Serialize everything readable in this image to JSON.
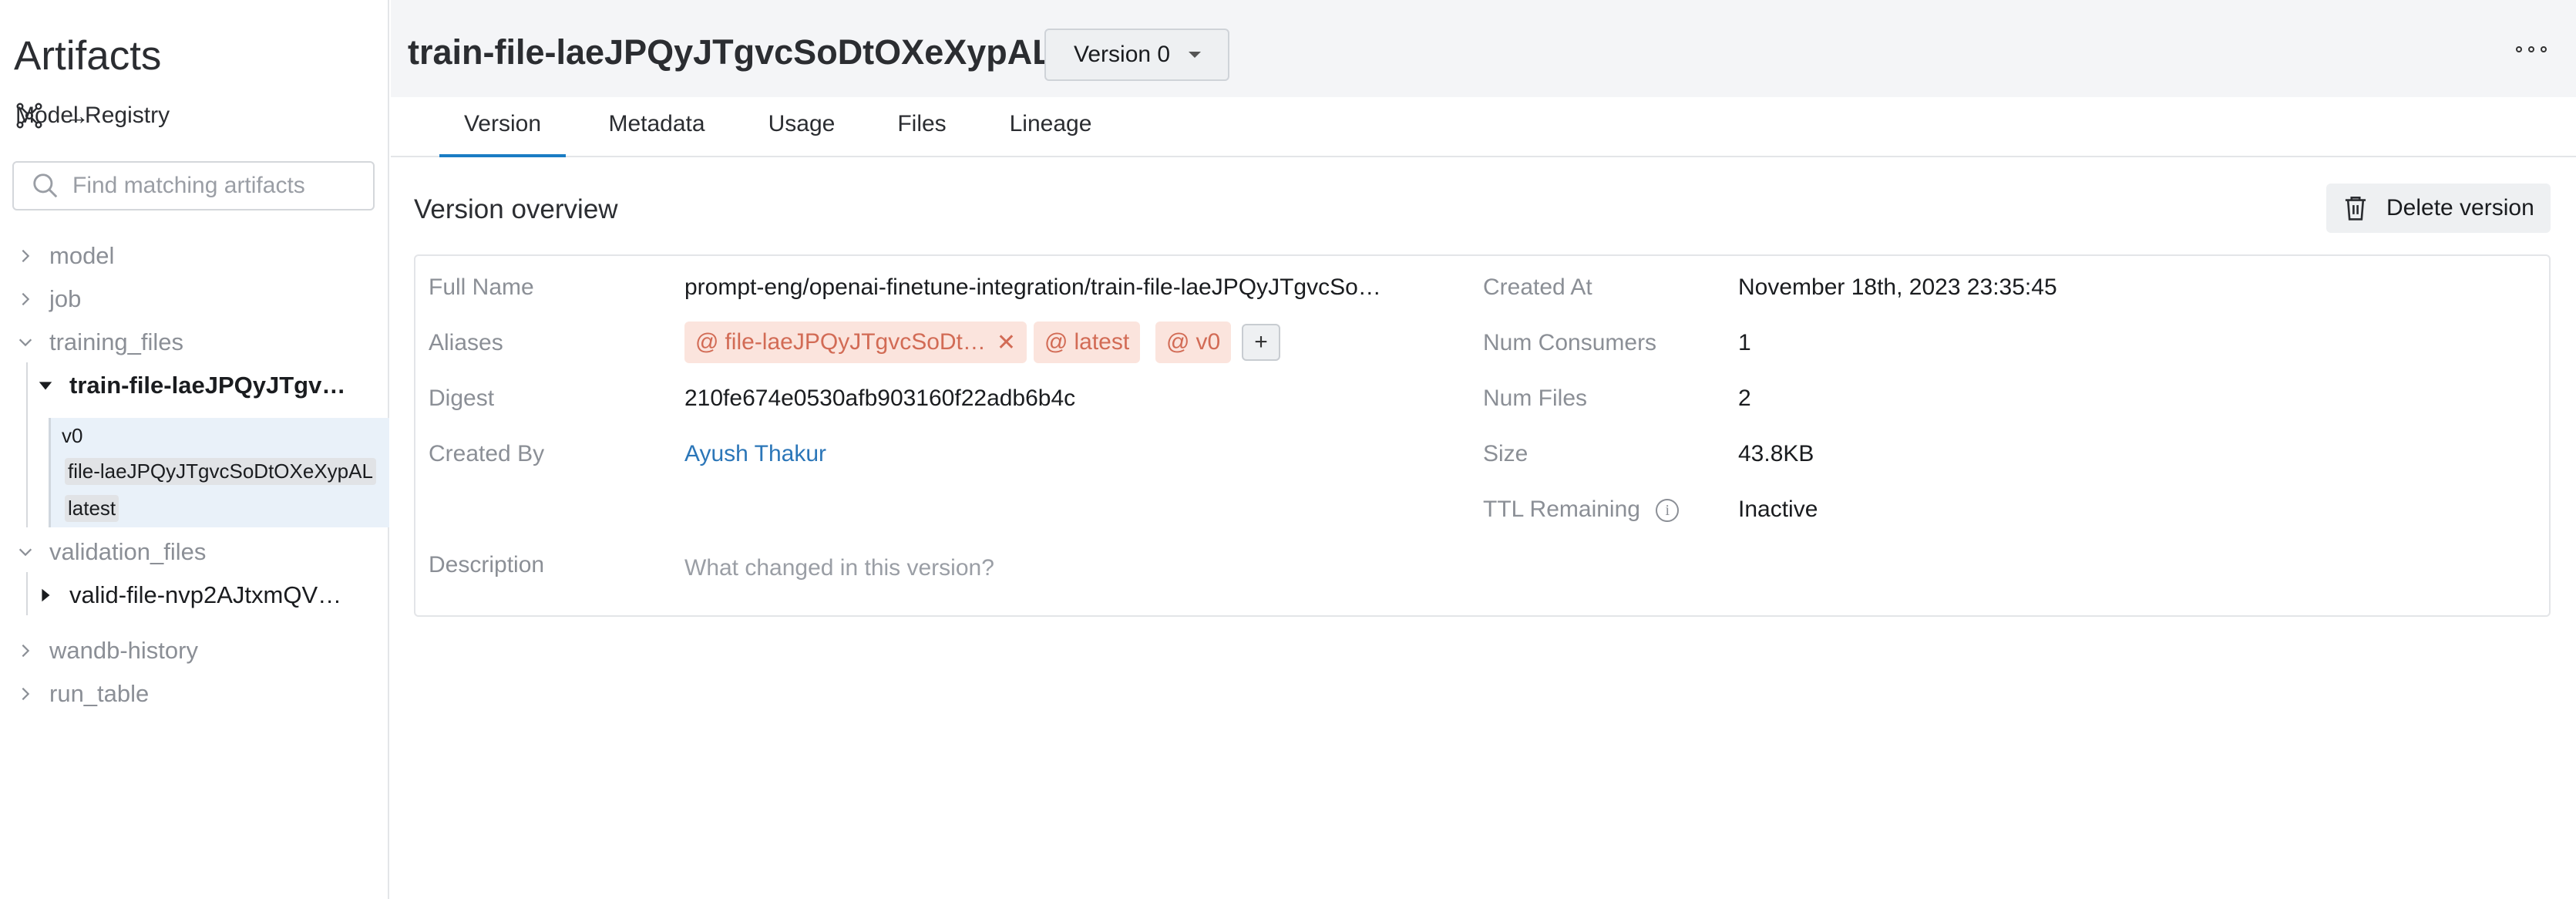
{
  "sidebar": {
    "title": "Artifacts",
    "registry_label": "Model Registry",
    "registry_arrow": "→",
    "search_placeholder": "Find matching artifacts",
    "categories": {
      "model": "model",
      "job": "job",
      "training_files": "training_files",
      "validation_files": "validation_files",
      "wandb_history": "wandb-history",
      "run_table": "run_table"
    },
    "train_file": "train-file-laeJPQyJTgv…",
    "valid_file": "valid-file-nvp2AJtxmQV…",
    "version": {
      "label": "v0",
      "aliases": [
        "file-laeJPQyJTgvcSoDtOXeXypAL",
        "latest"
      ]
    }
  },
  "header": {
    "title": "train-file-laeJPQyJTgvcSoDtOXeXypAL",
    "version_select": "Version 0"
  },
  "tabs": [
    "Version",
    "Metadata",
    "Usage",
    "Files",
    "Lineage"
  ],
  "overview": {
    "title": "Version overview",
    "delete_label": "Delete version",
    "labels": {
      "full_name": "Full Name",
      "aliases": "Aliases",
      "digest": "Digest",
      "created_by": "Created By",
      "description": "Description",
      "created_at": "Created At",
      "num_consumers": "Num Consumers",
      "num_files": "Num Files",
      "size": "Size",
      "ttl_remaining": "TTL Remaining"
    },
    "values": {
      "full_name": "prompt-eng/openai-finetune-integration/train-file-laeJPQyJTgvcSo…",
      "digest": "210fe674e0530afb903160f22adb6b4c",
      "created_by": "Ayush Thakur",
      "description_placeholder": "What changed in this version?",
      "created_at": "November 18th, 2023 23:35:45",
      "num_consumers": "1",
      "num_files": "2",
      "size": "43.8KB",
      "ttl_remaining": "Inactive"
    },
    "aliases": {
      "file": "file-laeJPQyJTgvcSoDt…",
      "latest": "latest",
      "v0": "v0",
      "at_symbol": "@",
      "remove_symbol": "✕",
      "add_symbol": "+"
    },
    "info_symbol": "i"
  },
  "colors": {
    "accent": "#1a7cc4",
    "link": "#2b76b8",
    "alias_bg": "#fbe4dd",
    "alias_text": "#d26b55",
    "selected_bg": "#e9f1f9"
  }
}
